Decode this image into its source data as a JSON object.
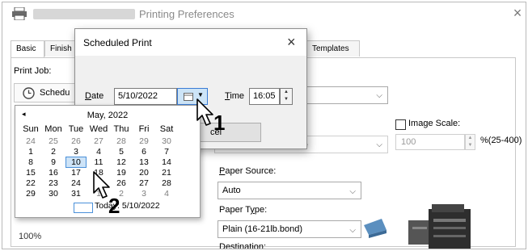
{
  "window": {
    "title": "Printing Preferences",
    "close_glyph": "×"
  },
  "tabs": [
    "Basic",
    "Finish",
    "Templates"
  ],
  "print_job": {
    "label": "Print Job:",
    "value": "Schedu"
  },
  "image_scale": {
    "label": "Image Scale:",
    "value": "100",
    "range": "%(25-400)"
  },
  "paper_source": {
    "label": "Paper Source:",
    "value": "Auto"
  },
  "paper_type": {
    "label": "Paper Type:",
    "value": "Plain (16-21lb.bond)"
  },
  "destination_label": "Destination:",
  "left_combo_value": "e",
  "zoom_value": "100%",
  "dialog": {
    "title": "Scheduled Print",
    "close_glyph": "×",
    "date_label": "Date",
    "date_value": "5/10/2022",
    "time_label": "Time",
    "time_value": "16:05",
    "cancel_label": "Cancel",
    "cancel_partial": "cel"
  },
  "calendar": {
    "month_year": "May, 2022",
    "prev_glyph": "◂",
    "next_glyph": "▸",
    "weekdays": [
      "Sun",
      "Mon",
      "Tue",
      "Wed",
      "Thu",
      "Fri",
      "Sat"
    ],
    "weeks": [
      [
        "24",
        "25",
        "26",
        "27",
        "28",
        "29",
        "30"
      ],
      [
        "1",
        "2",
        "3",
        "4",
        "5",
        "6",
        "7"
      ],
      [
        "8",
        "9",
        "10",
        "11",
        "12",
        "13",
        "14"
      ],
      [
        "15",
        "16",
        "17",
        "18",
        "19",
        "20",
        "21"
      ],
      [
        "22",
        "23",
        "24",
        "25",
        "26",
        "27",
        "28"
      ],
      [
        "29",
        "30",
        "31",
        "1",
        "2",
        "3",
        "4"
      ]
    ],
    "selected": "10",
    "today_label": "Today: 5/10/2022"
  },
  "callouts": [
    "1",
    "2"
  ],
  "colors": {
    "selected_bg": "#cde3f7",
    "selected_border": "#4a90d9",
    "dialog_bg": "#f0f0f0"
  }
}
